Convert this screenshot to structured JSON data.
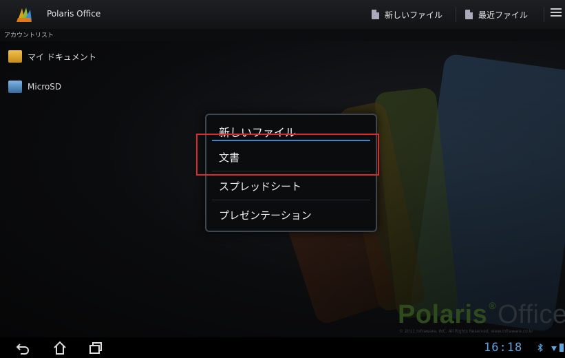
{
  "app": {
    "title": "Polaris Office",
    "new_file_label": "新しいファイル",
    "recent_file_label": "最近ファイル",
    "account_list_label": "アカウントリスト"
  },
  "sidebar": {
    "items": [
      {
        "label": "マイ ドキュメント",
        "icon": "folder-documents-icon"
      },
      {
        "label": "MicroSD",
        "icon": "sd-card-folder-icon"
      }
    ]
  },
  "dialog": {
    "title": "新しいファイル",
    "options": [
      "文書",
      "スプレッドシート",
      "プレゼンテーション"
    ]
  },
  "brand": {
    "logo_main": "Polaris",
    "logo_reg": "®",
    "logo_office": "Office",
    "copyright": "© 2011 Infraware, INC. All Rights Reserved. www.infraware.co.kr"
  },
  "system": {
    "clock": "16:18"
  },
  "colors": {
    "accent": "#3a86c8",
    "highlight": "#e0282a",
    "clock": "#5ea6e0"
  }
}
